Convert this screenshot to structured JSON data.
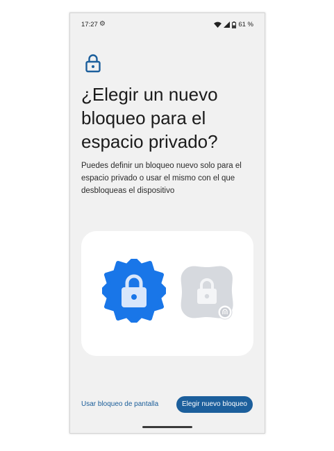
{
  "status_bar": {
    "time": "17:27",
    "battery_percent": "61 %",
    "icons": [
      "settings-gear-icon",
      "wifi-icon",
      "signal-icon",
      "battery-lock-icon"
    ]
  },
  "page": {
    "title": "¿Elegir un nuevo bloqueo para el espacio privado?",
    "description": "Puedes definir un bloqueo nuevo solo para el espacio privado o usar el mismo con el que desbloqueas el dispositivo"
  },
  "illustration": {
    "icons": [
      "lock-icon-primary",
      "lock-icon-secondary",
      "fingerprint-badge-icon"
    ]
  },
  "actions": {
    "secondary_label": "Usar bloqueo de pantalla",
    "primary_label": "Elegir nuevo bloqueo"
  },
  "colors": {
    "accent": "#1c5f9c",
    "illustration_blue": "#1976e8",
    "illustration_gray": "#d6d9de",
    "background": "#f1f1f1"
  }
}
